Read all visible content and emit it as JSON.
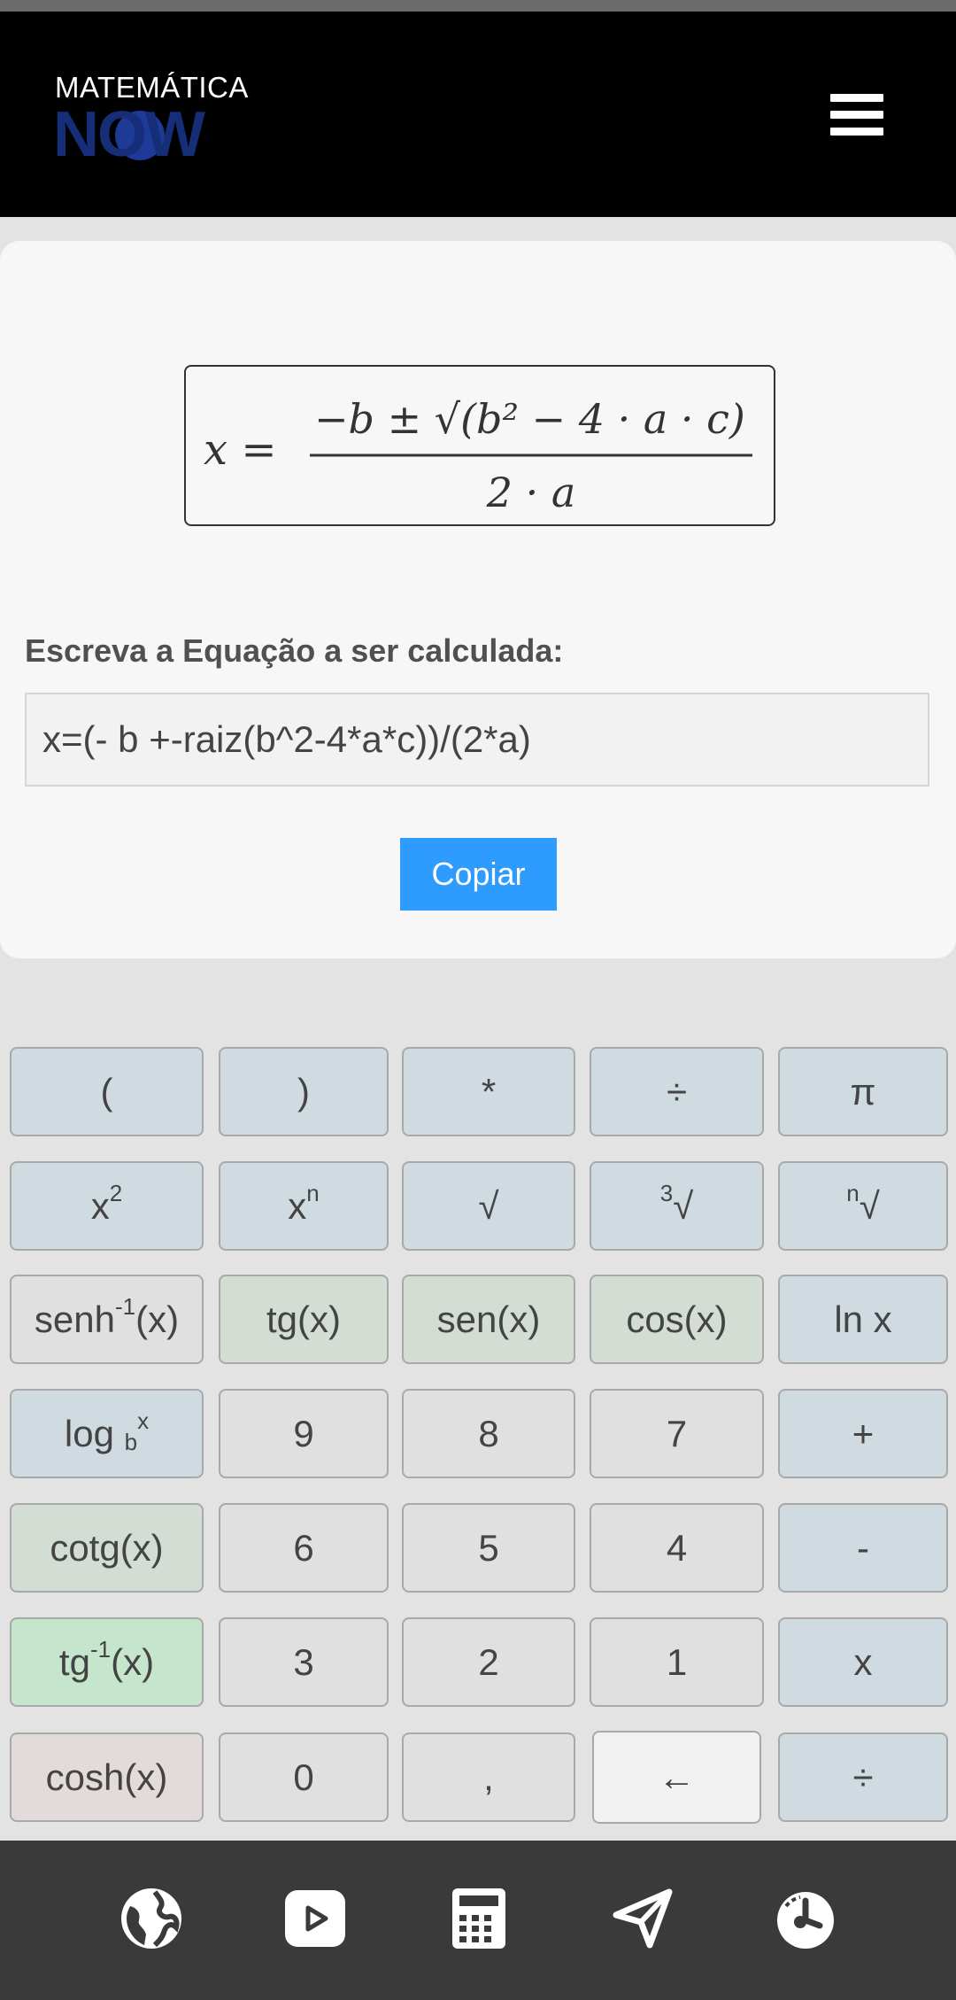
{
  "header": {
    "logo_top": "MATEMÁTICA",
    "logo_bottom": "NOW",
    "menu_icon": "hamburger-menu-icon"
  },
  "formula": {
    "lhs": "x =",
    "numerator": "−b ± √(b² − 4 · a · c)",
    "denominator": "2 · a"
  },
  "equation": {
    "label": "Escreva a Equação a ser calculada:",
    "value": "x=(- b +-raiz(b^2-4*a*c))/(2*a)"
  },
  "copy_label": "Copiar",
  "keys": {
    "open_paren": "(",
    "close_paren": ")",
    "multiply": "*",
    "divide": "÷",
    "pi": "π",
    "square_base": "x",
    "square_exp": "2",
    "power_base": "x",
    "power_exp": "n",
    "sqrt": "√",
    "cbrt_index": "3",
    "cbrt": "√",
    "nroot_index": "n",
    "nroot": "√",
    "senh_inv_base": "senh",
    "senh_inv_exp": "-1",
    "senh_inv_arg": "(x)",
    "tg": "tg(x)",
    "sen": "sen(x)",
    "cos": "cos(x)",
    "ln": "ln x",
    "log_base": "log",
    "log_sub": "b",
    "log_sup": "x",
    "n9": "9",
    "n8": "8",
    "n7": "7",
    "plus": "+",
    "cotg": "cotg(x)",
    "n6": "6",
    "n5": "5",
    "n4": "4",
    "minus": "-",
    "tg_inv_base": "tg",
    "tg_inv_exp": "-1",
    "tg_inv_arg": "(x)",
    "n3": "3",
    "n2": "2",
    "n1": "1",
    "times": "x",
    "cosh": "cosh(x)",
    "n0": "0",
    "comma": ",",
    "backspace": "←",
    "divide2": "÷"
  },
  "bottom_nav": [
    "globe-icon",
    "play-icon",
    "calculator-icon",
    "paper-plane-icon",
    "timer-icon"
  ]
}
